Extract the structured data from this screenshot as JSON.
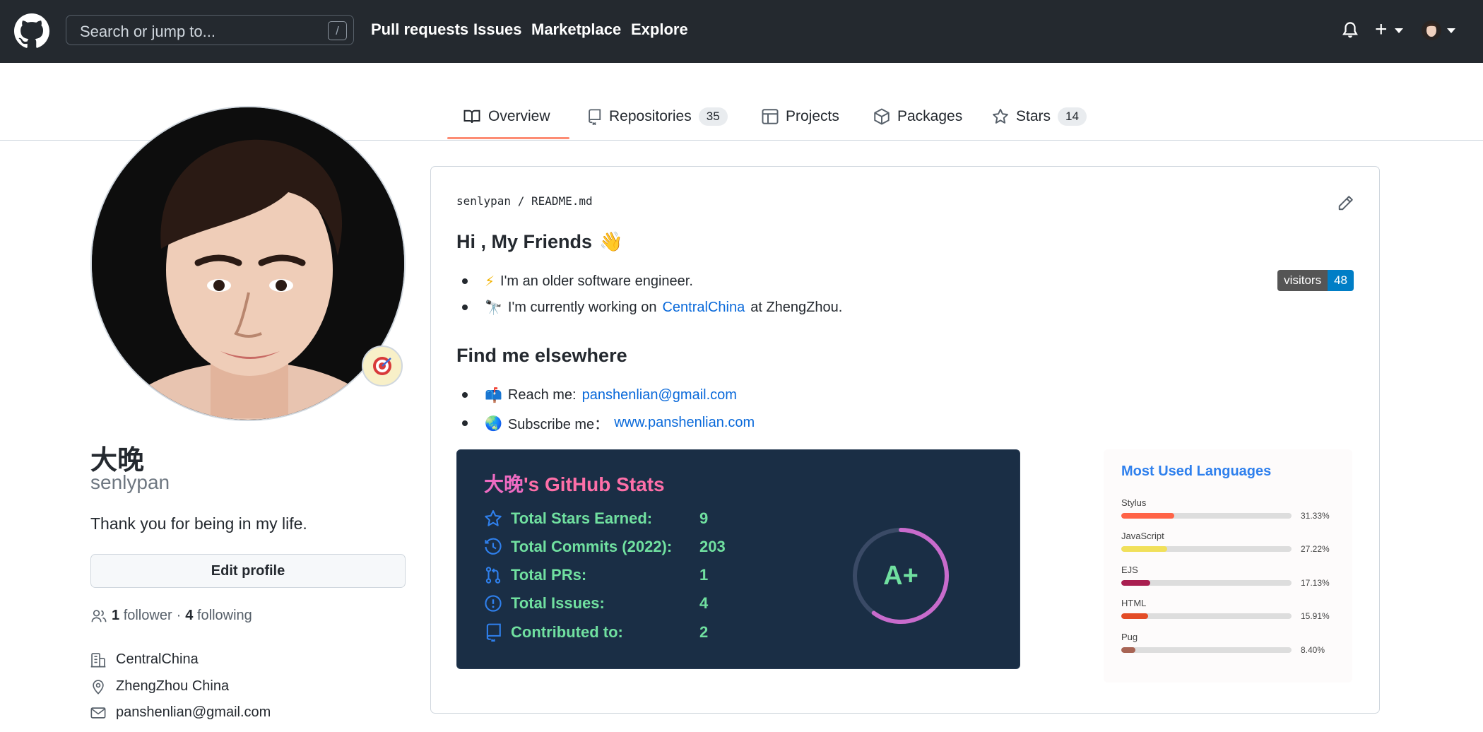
{
  "header": {
    "search_placeholder": "Search or jump to...",
    "search_shortcut": "/",
    "nav": [
      "Pull requests",
      "Issues",
      "Marketplace",
      "Explore"
    ],
    "plus_label": "+"
  },
  "tabs": [
    {
      "label": "Overview",
      "icon": "book-icon"
    },
    {
      "label": "Repositories",
      "count": "35",
      "icon": "repo-icon"
    },
    {
      "label": "Projects",
      "icon": "table-icon"
    },
    {
      "label": "Packages",
      "icon": "package-icon"
    },
    {
      "label": "Stars",
      "count": "14",
      "icon": "star-icon"
    }
  ],
  "profile": {
    "name": "大晚",
    "login": "senlypan",
    "bio": "Thank you for being in my life.",
    "edit_button": "Edit profile",
    "followers_count": "1",
    "followers_label": "follower",
    "separator": "·",
    "following_count": "4",
    "following_label": "following",
    "company": "CentralChina",
    "location": "ZhengZhou China",
    "email": "panshenlian@gmail.com"
  },
  "readme": {
    "path_owner": "senlypan",
    "path_sep": "/",
    "path_file": "README.md",
    "greeting": "Hi , My Friends",
    "greeting_emoji": "👋",
    "bullets1": [
      {
        "emoji": "⚡",
        "text": "I'm an older software engineer."
      },
      {
        "emoji": "🔭",
        "text_before": "I'm currently working on",
        "link": "CentralChina",
        "text_after": "at ZhengZhou."
      }
    ],
    "find_heading": "Find me elsewhere",
    "bullets2": [
      {
        "emoji": "📫",
        "text": "Reach me:",
        "link": "panshenlian@gmail.com"
      },
      {
        "emoji": "🌏",
        "text": "Subscribe me：",
        "link": "www.panshenlian.com"
      }
    ],
    "visitors_label": "visitors",
    "visitors_count": "48"
  },
  "stats": {
    "title_name": "大晚",
    "title_rest": "'s GitHub Stats",
    "rows": [
      {
        "label": "Total Stars Earned:",
        "value": "9",
        "icon": "star-icon"
      },
      {
        "label": "Total Commits (2022):",
        "value": "203",
        "icon": "history-icon"
      },
      {
        "label": "Total PRs:",
        "value": "1",
        "icon": "pull-request-icon"
      },
      {
        "label": "Total Issues:",
        "value": "4",
        "icon": "issue-icon"
      },
      {
        "label": "Contributed to:",
        "value": "2",
        "icon": "repo-icon"
      }
    ],
    "rank": "A+",
    "rank_progress_percent": 60,
    "colors": {
      "title": "#fe6fa8",
      "text": "#70e0a0",
      "bg": "#1a2e45",
      "icon": "#2f80ed",
      "ring": "#c86bcc"
    }
  },
  "languages": {
    "title": "Most Used Languages",
    "items": [
      {
        "name": "Stylus",
        "pct": "31.33%",
        "value": 31.33,
        "color": "#ff6347"
      },
      {
        "name": "JavaScript",
        "pct": "27.22%",
        "value": 27.22,
        "color": "#f1e05a"
      },
      {
        "name": "EJS",
        "pct": "17.13%",
        "value": 17.13,
        "color": "#a91e50"
      },
      {
        "name": "HTML",
        "pct": "15.91%",
        "value": 15.91,
        "color": "#e34c26"
      },
      {
        "name": "Pug",
        "pct": "8.40%",
        "value": 8.4,
        "color": "#a86454"
      }
    ]
  }
}
